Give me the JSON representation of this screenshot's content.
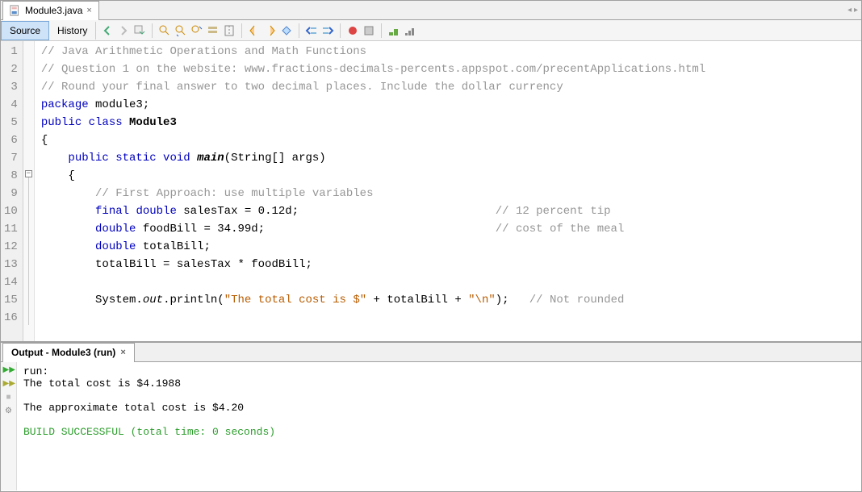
{
  "editorTab": {
    "fileName": "Module3.java",
    "closeGlyph": "×"
  },
  "subnav": {
    "source": "Source",
    "history": "History"
  },
  "code": {
    "lines": [
      {
        "n": 1,
        "type": "cmt",
        "text": "// Java Arithmetic Operations and Math Functions"
      },
      {
        "n": 2,
        "type": "cmt",
        "text": "// Question 1 on the website: www.fractions-decimals-percents.appspot.com/precentApplications.html"
      },
      {
        "n": 3,
        "type": "cmt",
        "text": "// Round your final answer to two decimal places. Include the dollar currency"
      },
      {
        "n": 4,
        "type": "pkg",
        "kw": "package",
        "rest": " module3;"
      },
      {
        "n": 5,
        "type": "cls",
        "kw": "public class ",
        "name": "Module3"
      },
      {
        "n": 6,
        "type": "plain",
        "text": "{"
      },
      {
        "n": 7,
        "type": "main",
        "pre": "    ",
        "kw": "public static void ",
        "name": "main",
        "args": "(String[] args)"
      },
      {
        "n": 8,
        "type": "plain",
        "text": "    {"
      },
      {
        "n": 9,
        "type": "cmt2",
        "pre": "        ",
        "text": "// First Approach: use multiple variables"
      },
      {
        "n": 10,
        "type": "decl1",
        "pre": "        ",
        "kw": "final double",
        "mid": " salesTax = 0.12d;",
        "pad": "                             ",
        "cmt": "// 12 percent tip"
      },
      {
        "n": 11,
        "type": "decl2",
        "pre": "        ",
        "kw": "double",
        "mid": " foodBill = 34.99d;",
        "pad": "                                  ",
        "cmt": "// cost of the meal"
      },
      {
        "n": 12,
        "type": "decl3",
        "pre": "        ",
        "kw": "double",
        "mid": " totalBill;"
      },
      {
        "n": 13,
        "type": "plain",
        "text": "        totalBill = salesTax * foodBill;"
      },
      {
        "n": 14,
        "type": "plain",
        "text": ""
      },
      {
        "n": 15,
        "type": "print",
        "pre": "        System.",
        "out": "out",
        "mid": ".println(",
        "s1": "\"The total cost is $\"",
        "mid2": " + totalBill + ",
        "s2": "\"\\n\"",
        "end": ");   ",
        "cmt": "// Not rounded"
      },
      {
        "n": 16,
        "type": "plain",
        "text": ""
      }
    ]
  },
  "output": {
    "tabTitle": "Output - Module3 (run)",
    "lines": {
      "l1": "run:",
      "l2": "The total cost is $4.1988",
      "l3": "",
      "l4": "The approximate total cost is $4.20",
      "l5": "",
      "l6": "BUILD SUCCESSFUL (total time: 0 seconds)"
    }
  }
}
